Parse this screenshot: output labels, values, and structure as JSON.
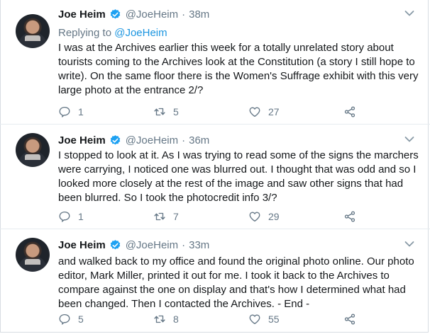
{
  "tweets": [
    {
      "name": "Joe Heim",
      "handle": "@JoeHeim",
      "separator": "·",
      "time": "38m",
      "replying_prefix": "Replying to ",
      "replying_handle": "@JoeHeim",
      "text": "I was at the Archives earlier this week for a totally unrelated story about tourists coming to the Archives look at the Constitution (a story I still hope to write). On the same floor there is the Women's Suffrage exhibit with this very large photo at the entrance 2/?",
      "replies": "1",
      "retweets": "5",
      "likes": "27"
    },
    {
      "name": "Joe Heim",
      "handle": "@JoeHeim",
      "separator": "·",
      "time": "36m",
      "text": "I stopped to look at it. As I was trying to read some of the signs the marchers were carrying, I noticed one was blurred out. I thought that was odd and so I looked more closely at the rest of the image and saw other signs that had been blurred. So I took the photocredit info 3/?",
      "replies": "1",
      "retweets": "7",
      "likes": "29"
    },
    {
      "name": "Joe Heim",
      "handle": "@JoeHeim",
      "separator": "·",
      "time": "33m",
      "text": "and walked back to my office and found the original photo online. Our photo editor, Mark Miller, printed it out for me. I took it back to the Archives to compare against the one on display and that's how I determined what had been changed. Then I contacted the Archives. - End -",
      "replies": "5",
      "retweets": "8",
      "likes": "55"
    }
  ],
  "icons": {
    "verified": "verified-badge-icon",
    "menu": "chevron-down-icon",
    "reply": "reply-icon",
    "retweet": "retweet-icon",
    "like": "heart-icon",
    "share": "share-icon"
  },
  "colors": {
    "verified": "#1da1f2",
    "link": "#1b95e0",
    "muted": "#657786",
    "text": "#14171a"
  }
}
